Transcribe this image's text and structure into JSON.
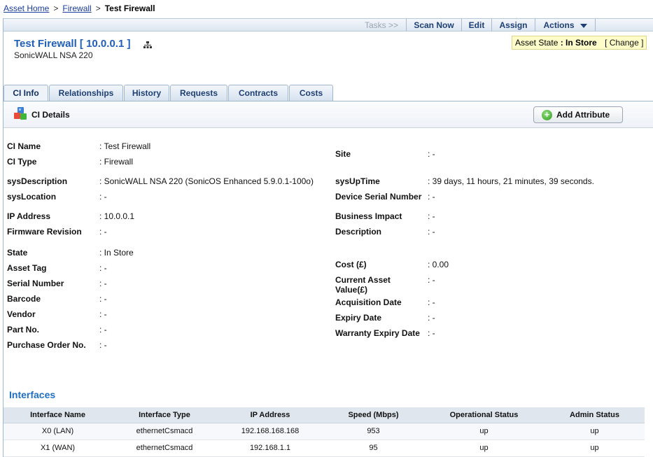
{
  "breadcrumb": {
    "home": "Asset Home",
    "sep1": ">",
    "category": "Firewall",
    "sep2": ">",
    "current": "Test Firewall"
  },
  "toolbar": {
    "tasks": "Tasks >>",
    "scan_now": "Scan Now",
    "edit": "Edit",
    "assign": "Assign",
    "actions": "Actions"
  },
  "header": {
    "title": "Test Firewall [ 10.0.0.1 ]",
    "subtitle": "SonicWALL NSA 220",
    "asset_state_label": "Asset State",
    "asset_state_value": ": In Store",
    "change": "[ Change ]"
  },
  "tabs": [
    "CI Info",
    "Relationships",
    "History",
    "Requests",
    "Contracts",
    "Costs"
  ],
  "details": {
    "title": "CI Details",
    "add_attribute": "Add Attribute"
  },
  "left_fields": [
    {
      "label": "CI Name",
      "value": ": Test Firewall"
    },
    {
      "label": "CI Type",
      "value": ": Firewall"
    },
    {
      "label": "sysDescription",
      "value": ": SonicWALL NSA 220 (SonicOS Enhanced 5.9.0.1-100o)"
    },
    {
      "label": "sysLocation",
      "value": ": -"
    },
    {
      "label": "IP Address",
      "value": ": 10.0.0.1"
    },
    {
      "label": "Firmware Revision",
      "value": ": -"
    },
    {
      "label": "State",
      "value": ": In Store"
    },
    {
      "label": "Asset Tag",
      "value": ": -"
    },
    {
      "label": "Serial Number",
      "value": ": -"
    },
    {
      "label": "Barcode",
      "value": ": -"
    },
    {
      "label": "Vendor",
      "value": ": -"
    },
    {
      "label": "Part No.",
      "value": ": -"
    },
    {
      "label": "Purchase Order No.",
      "value": ": -"
    }
  ],
  "right_fields": [
    {
      "label": "Site",
      "value": ": -"
    },
    {
      "label": "sysUpTime",
      "value": ": 39 days, 11 hours, 21 minutes, 39 seconds."
    },
    {
      "label": "Device Serial Number",
      "value": ": -"
    },
    {
      "label": "Business Impact",
      "value": ": -"
    },
    {
      "label": "Description",
      "value": ": -"
    },
    {
      "label": "Cost (£)",
      "value": ": 0.00"
    },
    {
      "label": "Current Asset Value(£)",
      "value": ": -"
    },
    {
      "label": "Acquisition Date",
      "value": ": -"
    },
    {
      "label": "Expiry Date",
      "value": ": -"
    },
    {
      "label": "Warranty Expiry Date",
      "value": ": -"
    }
  ],
  "interfaces": {
    "title": "Interfaces",
    "columns": [
      "Interface Name",
      "Interface Type",
      "IP Address",
      "Speed (Mbps)",
      "Operational Status",
      "Admin Status"
    ],
    "rows": [
      [
        "X0 (LAN)",
        "ethernetCsmacd",
        "192.168.168.168",
        "953",
        "up",
        "up"
      ],
      [
        "X1 (WAN)",
        "ethernetCsmacd",
        "192.168.1.1",
        "95",
        "up",
        "up"
      ]
    ]
  }
}
